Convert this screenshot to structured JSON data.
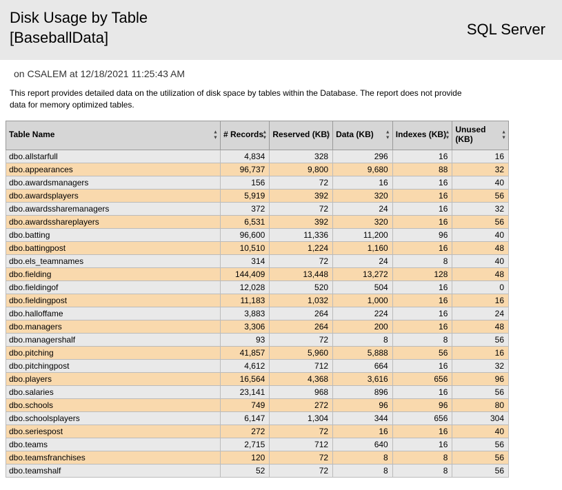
{
  "header": {
    "title_line1": "Disk Usage by Table",
    "title_line2": "[BaseballData]",
    "brand": "SQL Server"
  },
  "meta": {
    "text": "on CSALEM at 12/18/2021 11:25:43 AM"
  },
  "description": "This report provides detailed data on the utilization of disk space by tables within the Database. The report does not provide data for memory optimized tables.",
  "columns": {
    "name": "Table Name",
    "records": "# Records",
    "reserved": "Reserved (KB)",
    "data": "Data (KB)",
    "indexes": "Indexes (KB)",
    "unused": "Unused (KB)"
  },
  "rows": [
    {
      "name": "dbo.allstarfull",
      "records": "4,834",
      "reserved": "328",
      "data": "296",
      "indexes": "16",
      "unused": "16"
    },
    {
      "name": "dbo.appearances",
      "records": "96,737",
      "reserved": "9,800",
      "data": "9,680",
      "indexes": "88",
      "unused": "32"
    },
    {
      "name": "dbo.awardsmanagers",
      "records": "156",
      "reserved": "72",
      "data": "16",
      "indexes": "16",
      "unused": "40"
    },
    {
      "name": "dbo.awardsplayers",
      "records": "5,919",
      "reserved": "392",
      "data": "320",
      "indexes": "16",
      "unused": "56"
    },
    {
      "name": "dbo.awardssharemanagers",
      "records": "372",
      "reserved": "72",
      "data": "24",
      "indexes": "16",
      "unused": "32"
    },
    {
      "name": "dbo.awardsshareplayers",
      "records": "6,531",
      "reserved": "392",
      "data": "320",
      "indexes": "16",
      "unused": "56"
    },
    {
      "name": "dbo.batting",
      "records": "96,600",
      "reserved": "11,336",
      "data": "11,200",
      "indexes": "96",
      "unused": "40"
    },
    {
      "name": "dbo.battingpost",
      "records": "10,510",
      "reserved": "1,224",
      "data": "1,160",
      "indexes": "16",
      "unused": "48"
    },
    {
      "name": "dbo.els_teamnames",
      "records": "314",
      "reserved": "72",
      "data": "24",
      "indexes": "8",
      "unused": "40"
    },
    {
      "name": "dbo.fielding",
      "records": "144,409",
      "reserved": "13,448",
      "data": "13,272",
      "indexes": "128",
      "unused": "48"
    },
    {
      "name": "dbo.fieldingof",
      "records": "12,028",
      "reserved": "520",
      "data": "504",
      "indexes": "16",
      "unused": "0"
    },
    {
      "name": "dbo.fieldingpost",
      "records": "11,183",
      "reserved": "1,032",
      "data": "1,000",
      "indexes": "16",
      "unused": "16"
    },
    {
      "name": "dbo.halloffame",
      "records": "3,883",
      "reserved": "264",
      "data": "224",
      "indexes": "16",
      "unused": "24"
    },
    {
      "name": "dbo.managers",
      "records": "3,306",
      "reserved": "264",
      "data": "200",
      "indexes": "16",
      "unused": "48"
    },
    {
      "name": "dbo.managershalf",
      "records": "93",
      "reserved": "72",
      "data": "8",
      "indexes": "8",
      "unused": "56"
    },
    {
      "name": "dbo.pitching",
      "records": "41,857",
      "reserved": "5,960",
      "data": "5,888",
      "indexes": "56",
      "unused": "16"
    },
    {
      "name": "dbo.pitchingpost",
      "records": "4,612",
      "reserved": "712",
      "data": "664",
      "indexes": "16",
      "unused": "32"
    },
    {
      "name": "dbo.players",
      "records": "16,564",
      "reserved": "4,368",
      "data": "3,616",
      "indexes": "656",
      "unused": "96"
    },
    {
      "name": "dbo.salaries",
      "records": "23,141",
      "reserved": "968",
      "data": "896",
      "indexes": "16",
      "unused": "56"
    },
    {
      "name": "dbo.schools",
      "records": "749",
      "reserved": "272",
      "data": "96",
      "indexes": "96",
      "unused": "80"
    },
    {
      "name": "dbo.schoolsplayers",
      "records": "6,147",
      "reserved": "1,304",
      "data": "344",
      "indexes": "656",
      "unused": "304"
    },
    {
      "name": "dbo.seriespost",
      "records": "272",
      "reserved": "72",
      "data": "16",
      "indexes": "16",
      "unused": "40"
    },
    {
      "name": "dbo.teams",
      "records": "2,715",
      "reserved": "712",
      "data": "640",
      "indexes": "16",
      "unused": "56"
    },
    {
      "name": "dbo.teamsfranchises",
      "records": "120",
      "reserved": "72",
      "data": "8",
      "indexes": "8",
      "unused": "56"
    },
    {
      "name": "dbo.teamshalf",
      "records": "52",
      "reserved": "72",
      "data": "8",
      "indexes": "8",
      "unused": "56"
    }
  ]
}
